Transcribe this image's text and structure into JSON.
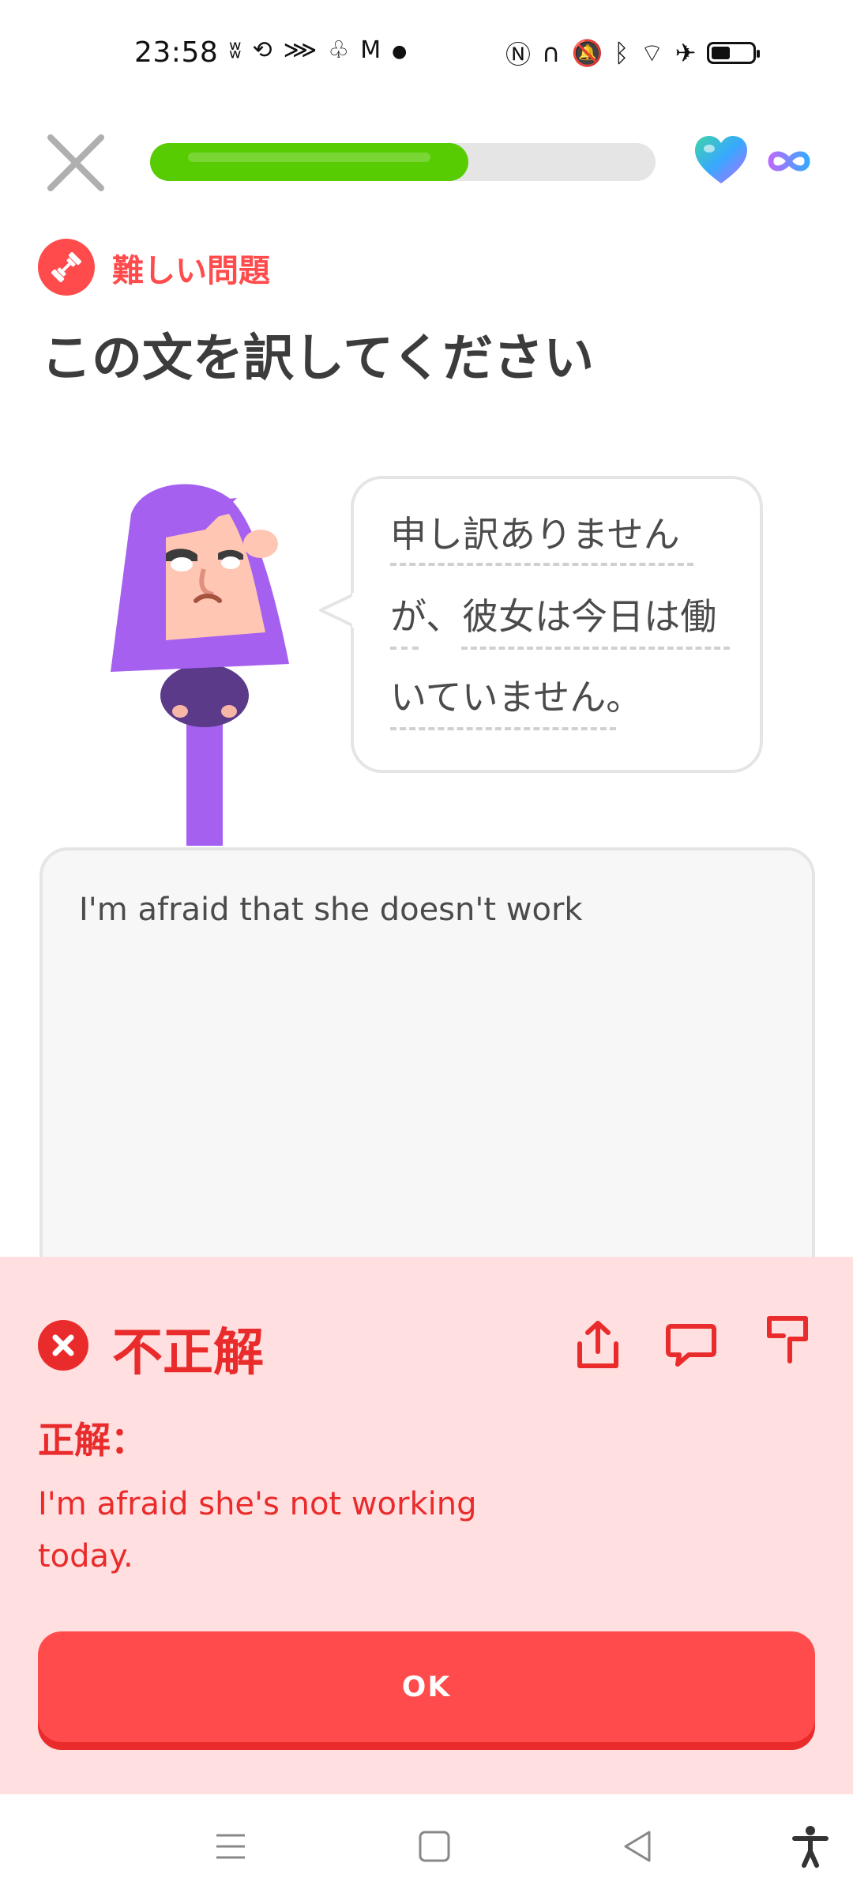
{
  "status_bar": {
    "time": "23:58",
    "left_icons": [
      "notification-icon",
      "sync-icon",
      "app-icon",
      "app-icon-2",
      "gmail-icon",
      "dot-icon"
    ],
    "right_icons": [
      "nfc-icon",
      "headphones-icon",
      "mute-icon",
      "bluetooth-icon",
      "wifi-icon",
      "airplane-icon",
      "battery-icon"
    ],
    "battery_level": 0.45
  },
  "header": {
    "progress": 0.63,
    "hearts": "infinite"
  },
  "challenge": {
    "badge_label": "難しい問題",
    "title": "この文を訳してください"
  },
  "prompt": {
    "lines": [
      "申し訳ありません",
      "が、彼女は今日は働",
      "いていません。"
    ]
  },
  "answer": {
    "value": "I'm afraid that she doesn't work"
  },
  "feedback": {
    "title": "不正解",
    "correct_label": "正解：",
    "correct_answer": "I'm afraid she's not working today.",
    "ok_label": "OK",
    "colors": {
      "error": "#ea2b2b",
      "panel": "#ffdfe0",
      "button": "#ff4b4b"
    }
  },
  "colors": {
    "progress": "#58cc02",
    "accent": "#ff4b4b"
  }
}
